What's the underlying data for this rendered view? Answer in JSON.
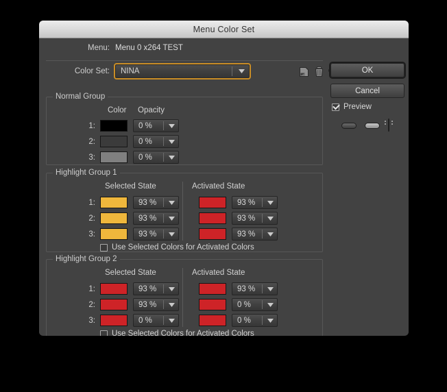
{
  "window": {
    "title": "Menu Color Set"
  },
  "header": {
    "menu_label": "Menu:",
    "menu_value": "Menu 0 x264 TEST",
    "colorset_label": "Color Set:",
    "colorset_value": "NINA",
    "icons": [
      "new-color-set-icon",
      "delete-color-set-icon",
      "import-color-set-icon",
      "export-color-set-icon"
    ]
  },
  "buttons": {
    "ok_label": "OK",
    "cancel_label": "Cancel"
  },
  "preview": {
    "label": "Preview",
    "checked": true,
    "swatch_states": [
      "normal-pill",
      "selected-pill",
      "activated-pill"
    ]
  },
  "colors": {
    "accent_focus": "#c98d26",
    "gold": "#efb73c",
    "red": "#ce2327",
    "black": "#000000",
    "dark_gray": "#3b3b3b",
    "mid_gray": "#808080",
    "dialog_bg": "#424242",
    "titlebar_top": "#ececec",
    "titlebar_bottom": "#c6c6c6"
  },
  "groups": [
    {
      "title": "Normal Group",
      "columns": [
        "Color",
        "Opacity"
      ],
      "rows": [
        {
          "num": "1:",
          "color": "#000000",
          "opacity": "0 %"
        },
        {
          "num": "2:",
          "color": "#3b3b3b",
          "opacity": "0 %"
        },
        {
          "num": "3:",
          "color": "#808080",
          "opacity": "0 %"
        }
      ]
    },
    {
      "title": "Highlight Group 1",
      "columns": [
        "Selected State",
        "Activated State"
      ],
      "rows": [
        {
          "num": "1:",
          "selected_color": "#efb73c",
          "selected_opacity": "93 %",
          "activated_color": "#ce2327",
          "activated_opacity": "93 %"
        },
        {
          "num": "2:",
          "selected_color": "#efb73c",
          "selected_opacity": "93 %",
          "activated_color": "#ce2327",
          "activated_opacity": "93 %"
        },
        {
          "num": "3:",
          "selected_color": "#efb73c",
          "selected_opacity": "93 %",
          "activated_color": "#ce2327",
          "activated_opacity": "93 %"
        }
      ],
      "use_selected_label": "Use Selected Colors for Activated Colors",
      "use_selected_checked": false
    },
    {
      "title": "Highlight Group 2",
      "columns": [
        "Selected State",
        "Activated State"
      ],
      "rows": [
        {
          "num": "1:",
          "selected_color": "#ce2327",
          "selected_opacity": "93 %",
          "activated_color": "#ce2327",
          "activated_opacity": "93 %"
        },
        {
          "num": "2:",
          "selected_color": "#ce2327",
          "selected_opacity": "93 %",
          "activated_color": "#ce2327",
          "activated_opacity": "0 %"
        },
        {
          "num": "3:",
          "selected_color": "#ce2327",
          "selected_opacity": "0 %",
          "activated_color": "#ce2327",
          "activated_opacity": "0 %"
        }
      ],
      "use_selected_label": "Use Selected Colors for Activated Colors",
      "use_selected_checked": false
    }
  ]
}
